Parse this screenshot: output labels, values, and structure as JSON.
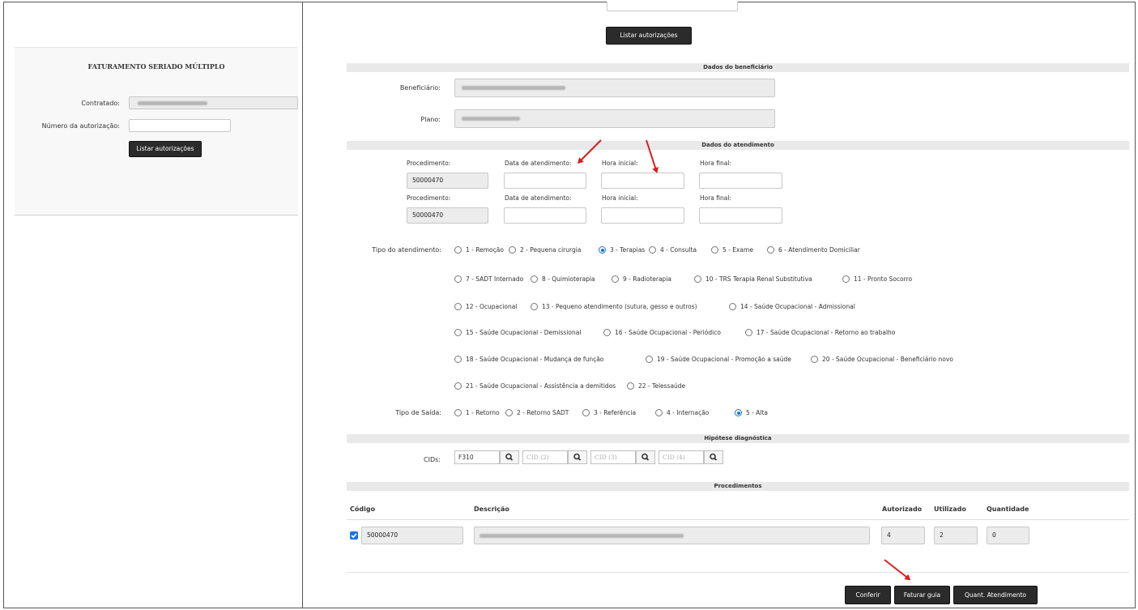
{
  "left": {
    "title": "FATURAMENTO SERIADO MÚLTIPLO",
    "contratado_label": "Contratado:",
    "autorizacao_label": "Número da autorização:",
    "list_button": "Listar autorizações"
  },
  "top": {
    "list_button": "Listar autorizações"
  },
  "beneficiario": {
    "section_title": "Dados do beneficiário",
    "beneficiario_label": "Beneficiário:",
    "plano_label": "Plano:"
  },
  "atendimento": {
    "section_title": "Dados do atendimento",
    "rows": [
      {
        "proc_label": "Procedimento:",
        "data_label": "Data de atendimento:",
        "hora_ini_label": "Hora inicial:",
        "hora_fim_label": "Hora final:",
        "proc_value": "50000470"
      },
      {
        "proc_label": "Procedimento:",
        "data_label": "Data de atendimento:",
        "hora_ini_label": "Hora inicial:",
        "hora_fim_label": "Hora final:",
        "proc_value": "50000470"
      }
    ],
    "tipo_label": "Tipo do atendimento:",
    "tipo_options": [
      "1 - Remoção",
      "2 - Pequena cirurgia",
      "3 - Terapias",
      "4 - Consulta",
      "5 - Exame",
      "6 - Atendimento Domiciliar",
      "7 - SADT Internado",
      "8 - Quimioterapia",
      "9 - Radioterapia",
      "10 - TRS Terapia Renal Substitutiva",
      "11 - Pronto Socorro",
      "12 - Ocupacional",
      "13 - Pequeno atendimento (sutura, gesso e outros)",
      "14 - Saúde Ocupacional - Admissional",
      "15 - Saúde Ocupacional - Demissional",
      "16 - Saúde Ocupacional - Periódico",
      "17 - Saúde Ocupacional - Retorno ao trabalho",
      "18 - Saúde Ocupacional - Mudança de função",
      "19 - Saúde Ocupacional - Promoção a saúde",
      "20 - Saúde Ocupacional - Beneficiário novo",
      "21 - Saúde Ocupacional - Assistência a demitidos",
      "22 - Telessaúde"
    ],
    "tipo_selected": "3 - Terapias",
    "saida_label": "Tipo de Saída:",
    "saida_options": [
      "1 - Retorno",
      "2 - Retorno SADT",
      "3 - Referência",
      "4 - Internação",
      "5 - Alta"
    ],
    "saida_selected": "5 - Alta"
  },
  "hipotese": {
    "section_title": "Hipótese diagnóstica",
    "cids_label": "CIDs:",
    "cid1_value": "F310",
    "cid2_placeholder": "CID (2)",
    "cid3_placeholder": "CID (3)",
    "cid4_placeholder": "CID (4)",
    "search_icon": "search-icon"
  },
  "procedimentos": {
    "section_title": "Procedimentos",
    "headers": {
      "codigo": "Código",
      "descricao": "Descrição",
      "autorizado": "Autorizado",
      "utilizado": "Utilizado",
      "quantidade": "Quantidade"
    },
    "row": {
      "codigo": "50000470",
      "autorizado": "4",
      "utilizado": "2",
      "quantidade": "0",
      "checked": true
    }
  },
  "actions": {
    "conferir": "Conferir",
    "faturar": "Faturar guia",
    "quant": "Quant. Atendimento"
  },
  "colors": {
    "accent": "#1a73e8",
    "dark_button": "#2b2b2b",
    "annotation_arrow": "#e01b1b"
  }
}
